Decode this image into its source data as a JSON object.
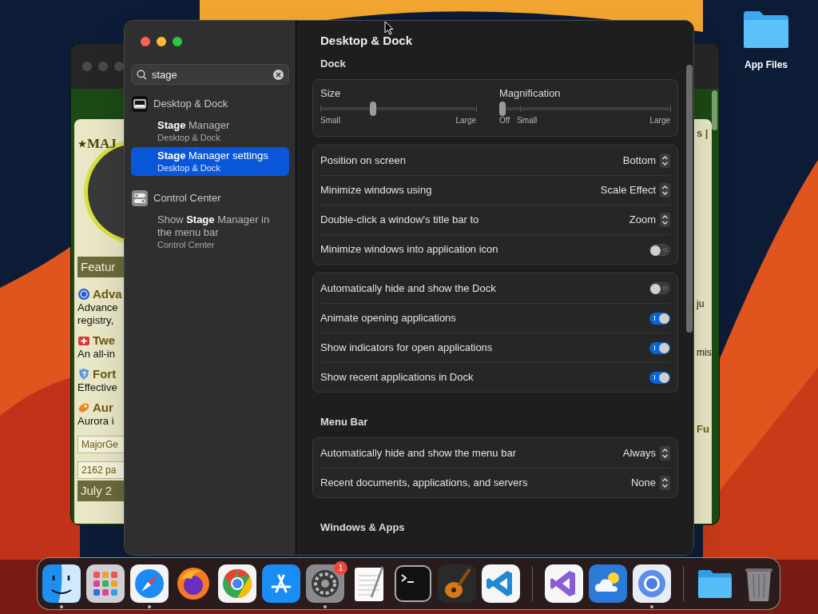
{
  "desktop_icons": [
    {
      "label": "App Files"
    }
  ],
  "background_window": {
    "logo_text": "MAJ",
    "left": [
      {
        "kind": "banner",
        "text": "Featur"
      },
      {
        "kind": "title",
        "text": "Adva"
      },
      {
        "kind": "text",
        "text": "Advance"
      },
      {
        "kind": "text",
        "text": "registry,"
      },
      {
        "kind": "title",
        "text": "Twe"
      },
      {
        "kind": "text",
        "text": "An all-in"
      },
      {
        "kind": "title",
        "text": "Fort"
      },
      {
        "kind": "text",
        "text": "Effective"
      },
      {
        "kind": "title",
        "text": "Aur"
      },
      {
        "kind": "text",
        "text": "Aurora i"
      },
      {
        "kind": "field",
        "text": "MajorGe"
      },
      {
        "kind": "field",
        "text": "2162 pa"
      },
      {
        "kind": "banner",
        "text": "July 2"
      }
    ],
    "right": [
      {
        "kind": "title",
        "text": "s |"
      },
      {
        "kind": "text",
        "text": "ju"
      },
      {
        "kind": "text",
        "text": "mis"
      },
      {
        "kind": "title",
        "text": "Fu"
      }
    ]
  },
  "settings_window": {
    "search": {
      "value": "stage"
    },
    "results": [
      {
        "kind": "section",
        "label": "Desktop & Dock"
      },
      {
        "kind": "result",
        "title": "**Stage** Manager",
        "subtitle": "Desktop & Dock",
        "selected": false
      },
      {
        "kind": "result",
        "title": "**Stage** Manager settings",
        "subtitle": "Desktop & Dock",
        "selected": true
      },
      {
        "kind": "section",
        "label": "Control Center"
      },
      {
        "kind": "result",
        "title": "Show **Stage** Manager in the menu bar",
        "subtitle": "Control Center",
        "selected": false
      }
    ],
    "title": "Desktop & Dock",
    "sections": [
      {
        "heading": "Dock",
        "groups": [
          {
            "rows": [
              {
                "kind": "sliders",
                "sliders": [
                  {
                    "label": "Size",
                    "level": 0.33,
                    "scale": [
                      "Small",
                      "Large"
                    ]
                  },
                  {
                    "label": "Magnification",
                    "level": 0,
                    "scale": [
                      "Off",
                      "Small",
                      "Large"
                    ]
                  }
                ]
              }
            ]
          },
          {
            "rows": [
              {
                "kind": "popup",
                "label": "Position on screen",
                "value": "Bottom"
              },
              {
                "kind": "popup",
                "label": "Minimize windows using",
                "value": "Scale Effect"
              },
              {
                "kind": "popup",
                "label": "Double-click a window's title bar to",
                "value": "Zoom"
              },
              {
                "kind": "toggle",
                "label": "Minimize windows into application icon",
                "on": false
              }
            ]
          },
          {
            "rows": [
              {
                "kind": "toggle",
                "label": "Automatically hide and show the Dock",
                "on": false
              },
              {
                "kind": "toggle",
                "label": "Animate opening applications",
                "on": true
              },
              {
                "kind": "toggle",
                "label": "Show indicators for open applications",
                "on": true
              },
              {
                "kind": "toggle",
                "label": "Show recent applications in Dock",
                "on": true
              }
            ]
          }
        ]
      },
      {
        "heading": "Menu Bar",
        "groups": [
          {
            "rows": [
              {
                "kind": "popup",
                "label": "Automatically hide and show the menu bar",
                "value": "Always"
              },
              {
                "kind": "popup",
                "label": "Recent documents, applications, and servers",
                "value": "None"
              }
            ]
          }
        ]
      },
      {
        "heading": "Windows & Apps"
      }
    ]
  },
  "dock": {
    "items": [
      {
        "kind": "finder",
        "running": true
      },
      {
        "kind": "launchpad",
        "running": false
      },
      {
        "kind": "safari",
        "running": true
      },
      {
        "kind": "firefox",
        "running": false
      },
      {
        "kind": "chrome",
        "running": false
      },
      {
        "kind": "appstore",
        "running": false
      },
      {
        "kind": "settings",
        "running": true,
        "badge": "1"
      },
      {
        "kind": "textedit",
        "running": false
      },
      {
        "kind": "terminal",
        "running": false
      },
      {
        "kind": "garageband",
        "running": false
      },
      {
        "kind": "vscode",
        "running": false
      },
      {
        "kind": "separator"
      },
      {
        "kind": "visualstudio",
        "running": false
      },
      {
        "kind": "weather",
        "running": false
      },
      {
        "kind": "chromium",
        "running": true
      },
      {
        "kind": "separator"
      },
      {
        "kind": "folder",
        "running": false
      },
      {
        "kind": "trash",
        "running": false
      }
    ]
  }
}
